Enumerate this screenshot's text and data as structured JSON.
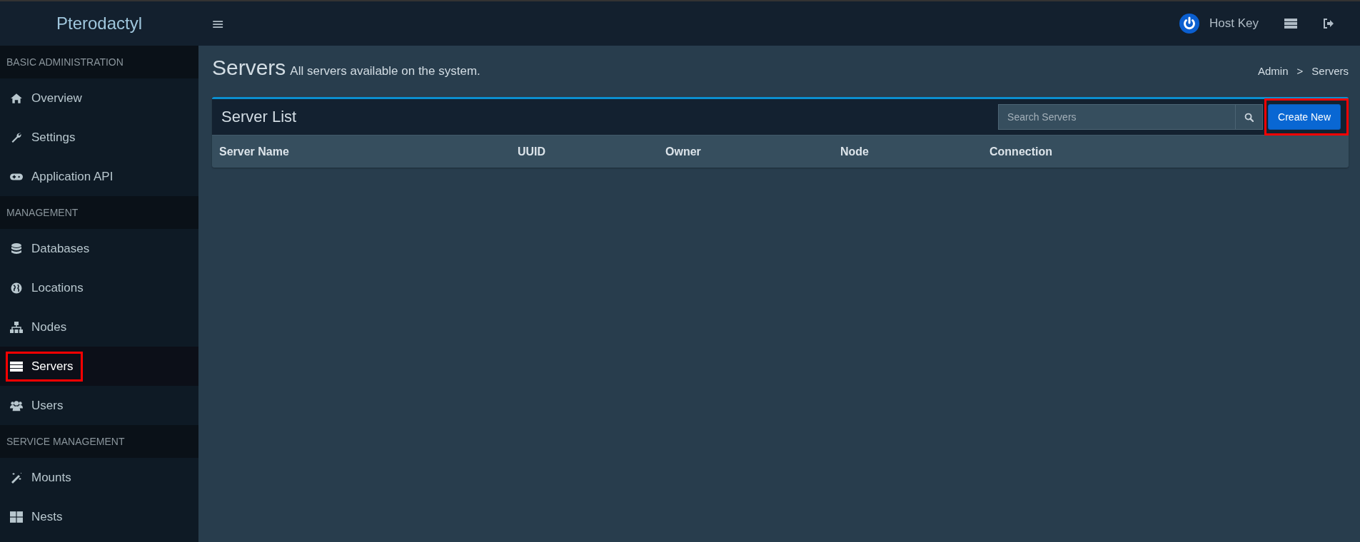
{
  "brand": "Pterodactyl",
  "header": {
    "menu_glyph": "≡",
    "user": "Host Key"
  },
  "sidebar": [
    {
      "kind": "section",
      "label": "BASIC ADMINISTRATION"
    },
    {
      "kind": "item",
      "label": "Overview",
      "selected": false,
      "highlighted": false
    },
    {
      "kind": "item",
      "label": "Settings",
      "selected": false,
      "highlighted": false
    },
    {
      "kind": "item",
      "label": "Application API",
      "selected": false,
      "highlighted": false
    },
    {
      "kind": "section",
      "label": "MANAGEMENT"
    },
    {
      "kind": "item",
      "label": "Databases",
      "selected": false,
      "highlighted": false
    },
    {
      "kind": "item",
      "label": "Locations",
      "selected": false,
      "highlighted": false
    },
    {
      "kind": "item",
      "label": "Nodes",
      "selected": false,
      "highlighted": false
    },
    {
      "kind": "item",
      "label": "Servers",
      "selected": true,
      "highlighted": true
    },
    {
      "kind": "item",
      "label": "Users",
      "selected": false,
      "highlighted": false
    },
    {
      "kind": "section",
      "label": "SERVICE MANAGEMENT"
    },
    {
      "kind": "item",
      "label": "Mounts",
      "selected": false,
      "highlighted": false
    },
    {
      "kind": "item",
      "label": "Nests",
      "selected": false,
      "highlighted": false
    }
  ],
  "page": {
    "title": "Servers",
    "subtitle": "All servers available on the system.",
    "breadcrumb": [
      "Admin",
      ">",
      "Servers"
    ]
  },
  "box": {
    "title": "Server List",
    "search": {
      "placeholder": "Search Servers"
    },
    "create_button": {
      "label": "Create New",
      "highlighted": true
    },
    "columns": [
      "Server Name",
      "UUID",
      "Owner",
      "Node",
      "Connection"
    ]
  }
}
